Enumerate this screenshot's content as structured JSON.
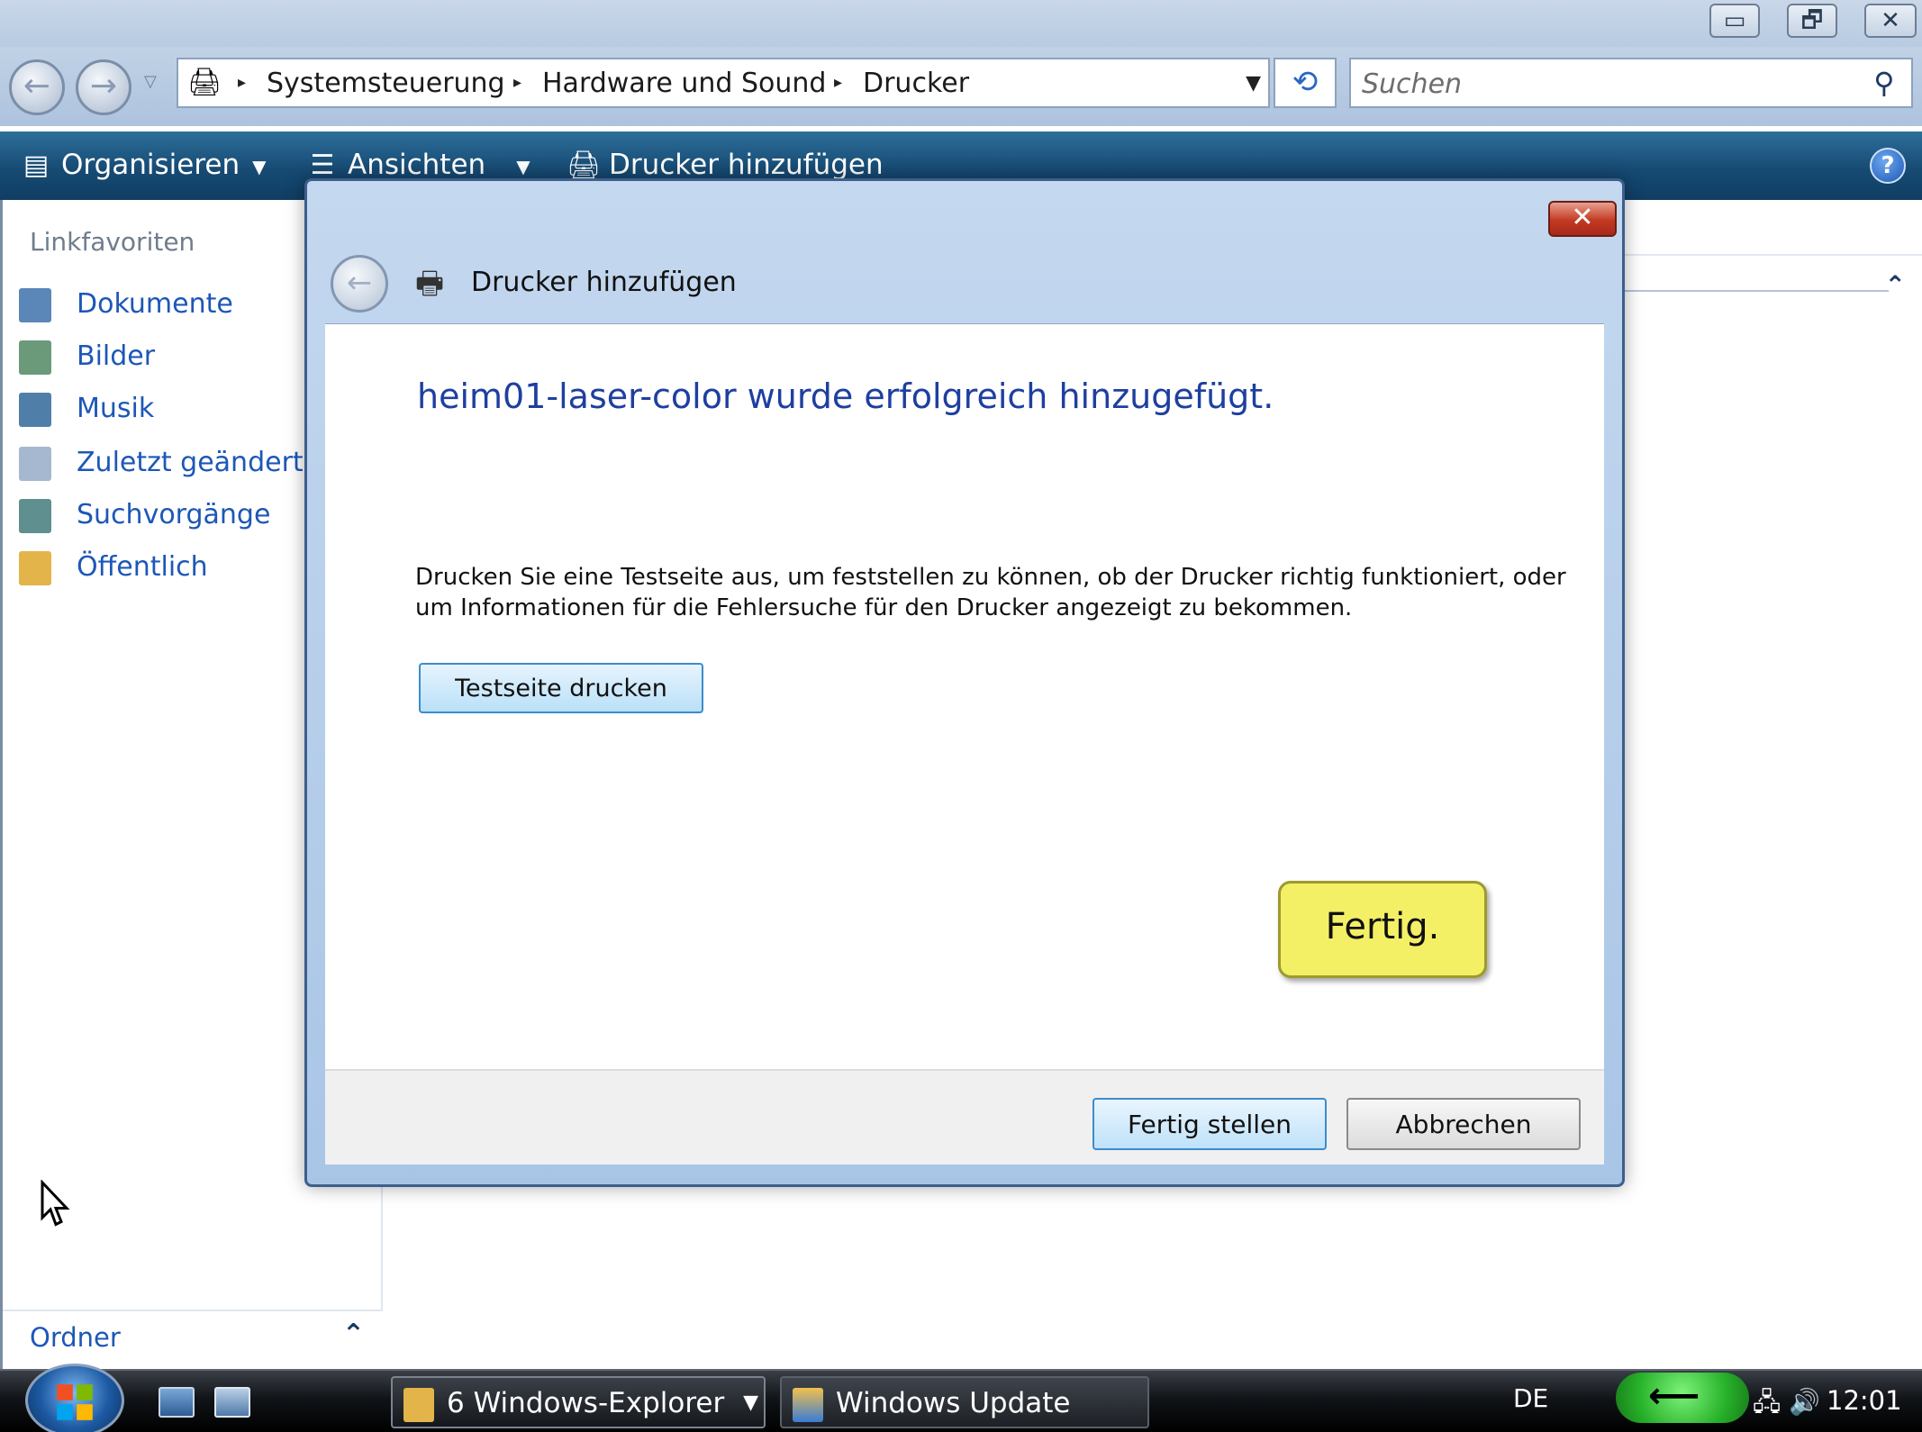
{
  "window": {
    "minimize_glyph": "▭",
    "maximize_glyph": "🗗",
    "close_glyph": "✕"
  },
  "address": {
    "crumbs": [
      "Systemsteuerung",
      "Hardware und Sound",
      "Drucker"
    ],
    "icon": "control-panel-icon"
  },
  "search": {
    "placeholder": "Suchen"
  },
  "toolbar": {
    "organize": "Organisieren",
    "views": "Ansichten",
    "add_printer": "Drucker hinzufügen"
  },
  "sidebar": {
    "title": "Linkfavoriten",
    "items": [
      {
        "label": "Dokumente",
        "icon": "documents-icon",
        "color": "#5b86b8"
      },
      {
        "label": "Bilder",
        "icon": "pictures-icon",
        "color": "#6a9a7a"
      },
      {
        "label": "Musik",
        "icon": "music-icon",
        "color": "#4f7fa8"
      },
      {
        "label": "Zuletzt geändert",
        "icon": "recent-icon",
        "color": "#a6b8cf"
      },
      {
        "label": "Suchvorgänge",
        "icon": "searches-icon",
        "color": "#5f8f8f"
      },
      {
        "label": "Öffentlich",
        "icon": "public-folder-icon",
        "color": "#e3b44a"
      }
    ],
    "folders_label": "Ordner"
  },
  "dialog": {
    "title": "Drucker hinzufügen",
    "heading": "heim01-laser-color wurde erfolgreich hinzugefügt.",
    "description_line1": "Drucken Sie eine Testseite aus, um feststellen zu können, ob der Drucker richtig funktioniert, oder",
    "description_line2": "um Informationen für die Fehlersuche für den Drucker angezeigt zu bekommen.",
    "test_page_button": "Testseite drucken",
    "finish_button": "Fertig stellen",
    "cancel_button": "Abbrechen",
    "callout": "Fertig."
  },
  "taskbar": {
    "explorer_task": "6 Windows-Explorer",
    "update_task": "Windows Update",
    "language": "DE",
    "clock": "12:01"
  },
  "colors": {
    "toolbar": "#174b74",
    "link": "#1d57b7",
    "dialog_heading": "#1e3fa0",
    "callout": "#f4f065"
  }
}
